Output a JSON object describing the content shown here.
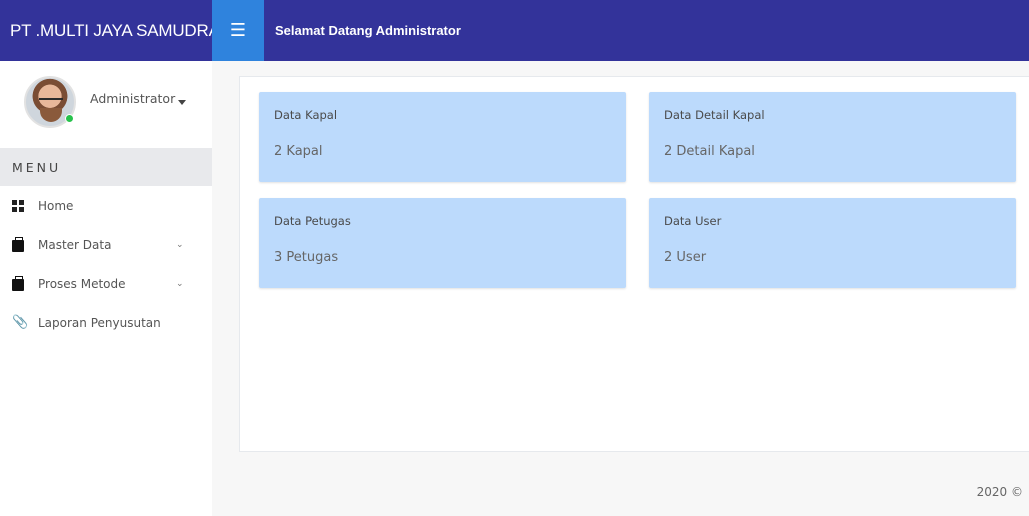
{
  "brand": {
    "title": "PT .MULTI JAYA SAMUDRA"
  },
  "topbar": {
    "menu_icon": "hamburger-icon",
    "welcome": "Selamat Datang Administrator"
  },
  "colors": {
    "header": "#33339a",
    "toggle": "#2f83dd",
    "card": "#bcdafc",
    "online": "#27c24c"
  },
  "sidebar": {
    "user": {
      "name": "Administrator",
      "status": "online"
    },
    "menu_header": "MENU",
    "items": [
      {
        "label": "Home",
        "icon": "grid-icon",
        "has_submenu": false
      },
      {
        "label": "Master Data",
        "icon": "briefcase-icon",
        "has_submenu": true
      },
      {
        "label": "Proses Metode",
        "icon": "briefcase-icon",
        "has_submenu": true
      },
      {
        "label": "Laporan Penyusutan",
        "icon": "paperclip-icon",
        "has_submenu": false
      }
    ]
  },
  "cards": [
    {
      "title": "Data Kapal",
      "value": "2 Kapal"
    },
    {
      "title": "Data Detail Kapal",
      "value": "2 Detail Kapal"
    },
    {
      "title": "Data Petugas",
      "value": "3 Petugas"
    },
    {
      "title": "Data User",
      "value": "2 User"
    }
  ],
  "footer": {
    "text": "2020 ©"
  }
}
